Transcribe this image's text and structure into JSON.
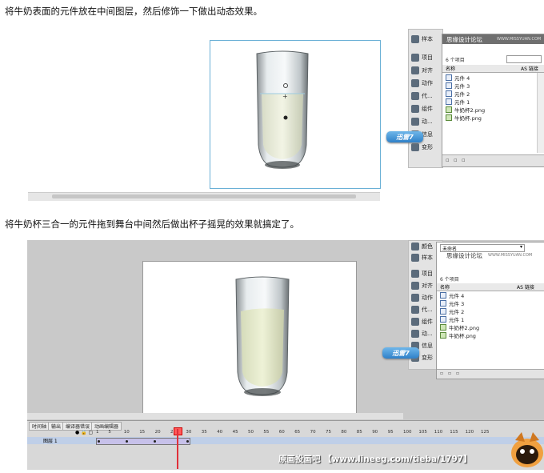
{
  "captions": {
    "step1": "将牛奶表面的元件放在中间图层，然后修饰一下做出动态效果。",
    "step2": "将牛奶杯三合一的元件拖到舞台中间然后做出杯子摇晃的效果就搞定了。"
  },
  "panel1": {
    "strip_items": [
      "样本",
      "项目",
      "对齐",
      "动作",
      "代...",
      "组件",
      "动...",
      "信息",
      "变形"
    ],
    "library": {
      "title": "思缘设计论坛",
      "site": "WWW.MISSYUAN.COM",
      "count": "6 个项目",
      "col_name": "名称",
      "col_link": "AS 链接",
      "items": [
        {
          "name": "元件 4",
          "kind": "symbol"
        },
        {
          "name": "元件 3",
          "kind": "symbol"
        },
        {
          "name": "元件 2",
          "kind": "symbol"
        },
        {
          "name": "元件 1",
          "kind": "symbol"
        },
        {
          "name": "牛奶杯2.png",
          "kind": "bitmap"
        },
        {
          "name": "牛奶杯.png",
          "kind": "bitmap"
        }
      ]
    },
    "xunlei_label": "迅雷7"
  },
  "panel2": {
    "strip_items": [
      "颜色",
      "样本",
      "项目",
      "对齐",
      "动作",
      "代...",
      "组件",
      "动...",
      "信息",
      "变形"
    ],
    "library": {
      "dropdown": "未命名",
      "title": "思缘设计论坛",
      "site": "WWW.MISSYUAN.COM",
      "count": "6 个项目",
      "col_name": "名称",
      "col_link": "AS 链接",
      "items": [
        {
          "name": "元件 4",
          "kind": "symbol"
        },
        {
          "name": "元件 3",
          "kind": "symbol"
        },
        {
          "name": "元件 2",
          "kind": "symbol"
        },
        {
          "name": "元件 1",
          "kind": "symbol"
        },
        {
          "name": "牛奶杯2.png",
          "kind": "bitmap"
        },
        {
          "name": "牛奶杯.png",
          "kind": "bitmap"
        }
      ]
    },
    "xunlei_label": "迅雷7",
    "timeline": {
      "tabs": [
        "时间轴",
        "输出",
        "编译器错误",
        "动画编辑器"
      ],
      "layer_name": "图层 1",
      "ruler": [
        "1",
        "5",
        "10",
        "15",
        "20",
        "25",
        "30",
        "35",
        "40",
        "45",
        "50",
        "55",
        "60",
        "65",
        "70",
        "75",
        "80",
        "85",
        "90",
        "95",
        "100",
        "105",
        "110",
        "115",
        "120",
        "125"
      ],
      "current_frame": 25
    },
    "watermark": "原画投画吧 【www.lineeg.com/tieba/1797】"
  },
  "colors": {
    "stage_border": "#6ab0d6",
    "timeline_selection": "#c7c1ea",
    "playhead": "#e0303a",
    "xunlei": "#2f80c8"
  }
}
